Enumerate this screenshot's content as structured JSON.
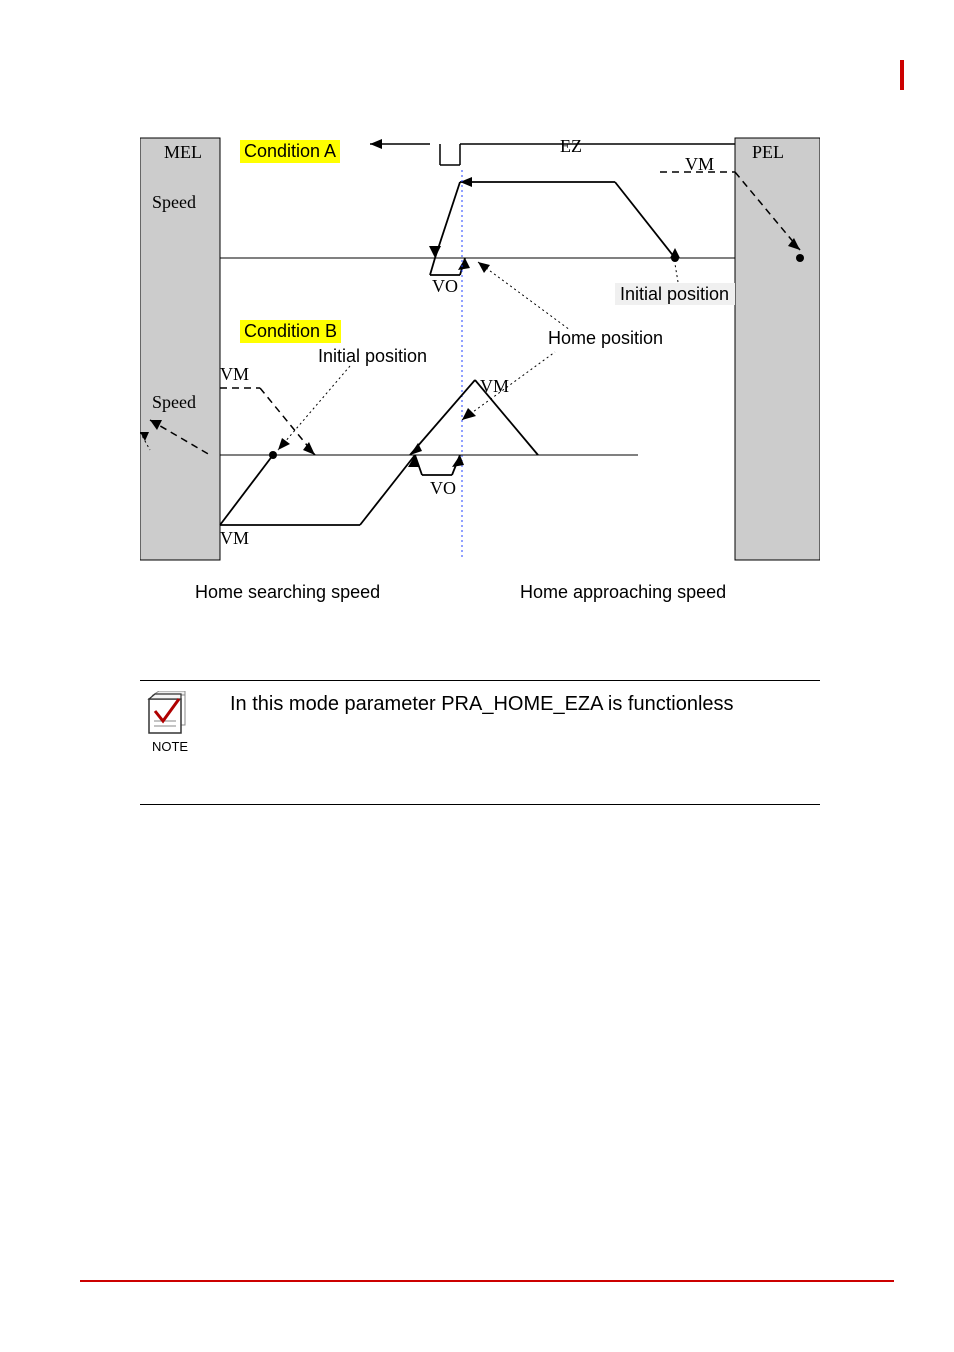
{
  "diagram": {
    "condition_a": "Condition A",
    "condition_b": "Condition B",
    "mel": "MEL",
    "pel": "PEL",
    "speed_top": "Speed",
    "speed_bottom": "Speed",
    "ez": "EZ",
    "vm_tr": "VM",
    "vm_bl1": "VM",
    "vm_bl2": "VM",
    "vm_mid": "VM",
    "vo_top": "VO",
    "vo_bottom": "VO",
    "initial_position_right": "Initial position",
    "initial_position_left": "Initial position",
    "home_position": "Home position",
    "home_searching_speed": "Home searching speed",
    "home_approaching_speed": "Home approaching speed"
  },
  "note": {
    "caption": "NOTE",
    "text": "In this mode parameter PRA_HOME_EZA is functionless"
  }
}
